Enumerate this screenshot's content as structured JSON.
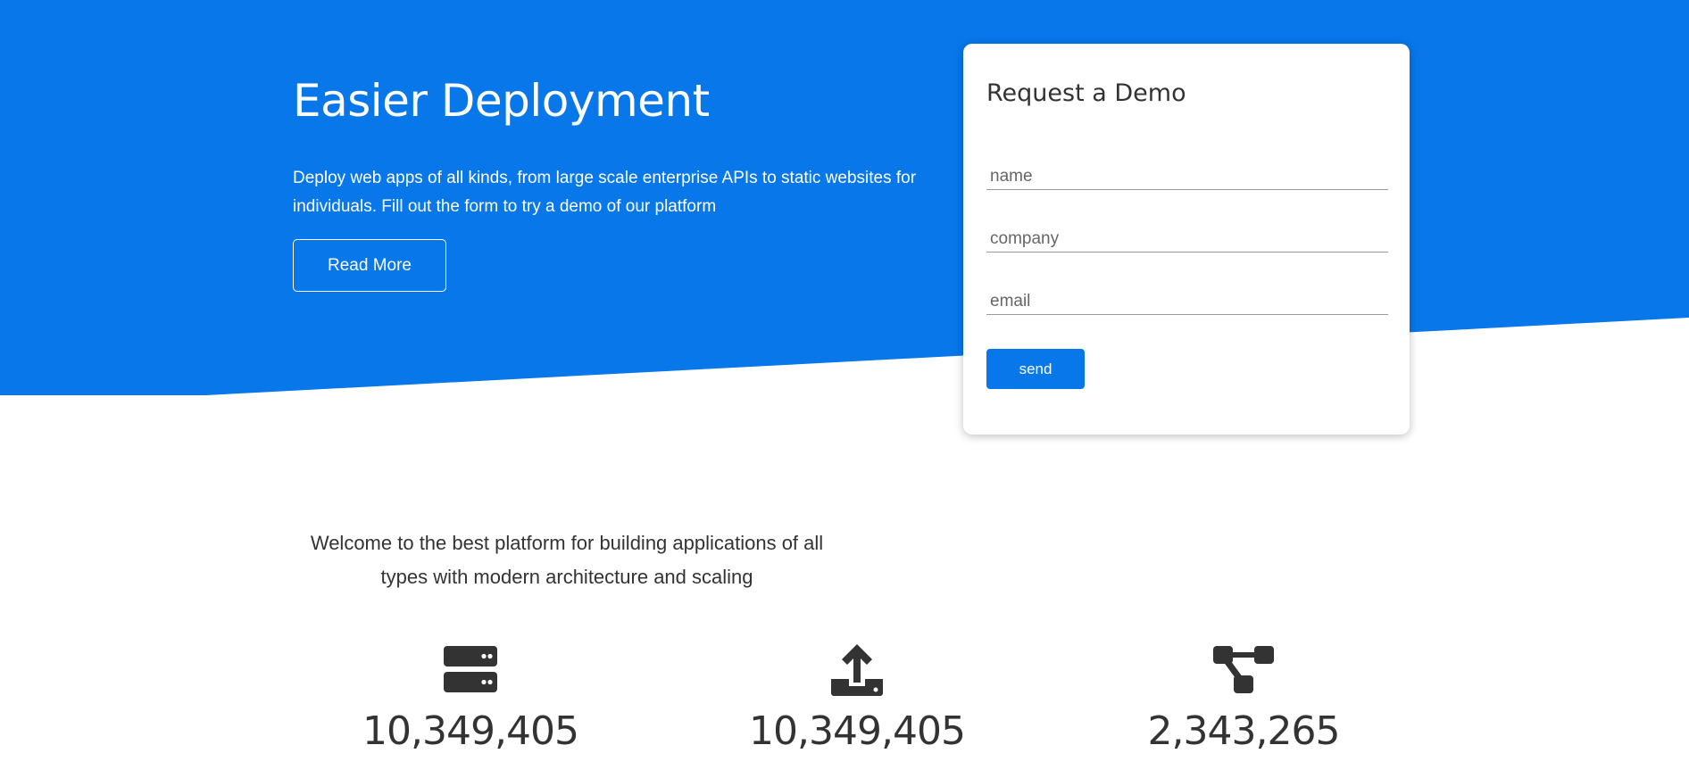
{
  "colors": {
    "brand_blue": "#0777ea",
    "text_dark": "#333333",
    "white": "#ffffff"
  },
  "hero": {
    "title": "Easier Deployment",
    "description": "Deploy web apps of all kinds, from large scale enterprise APIs to static websites for individuals. Fill out the form to try a demo of our platform",
    "read_more_label": "Read More"
  },
  "demo_form": {
    "title": "Request a Demo",
    "fields": {
      "name_placeholder": "name",
      "company_placeholder": "company",
      "email_placeholder": "email"
    },
    "send_label": "send"
  },
  "welcome": {
    "text": "Welcome to the best platform for building applications of all types with modern architecture and scaling"
  },
  "stats": [
    {
      "icon": "server-icon",
      "value": "10,349,405"
    },
    {
      "icon": "upload-icon",
      "value": "10,349,405"
    },
    {
      "icon": "network-icon",
      "value": "2,343,265"
    }
  ]
}
